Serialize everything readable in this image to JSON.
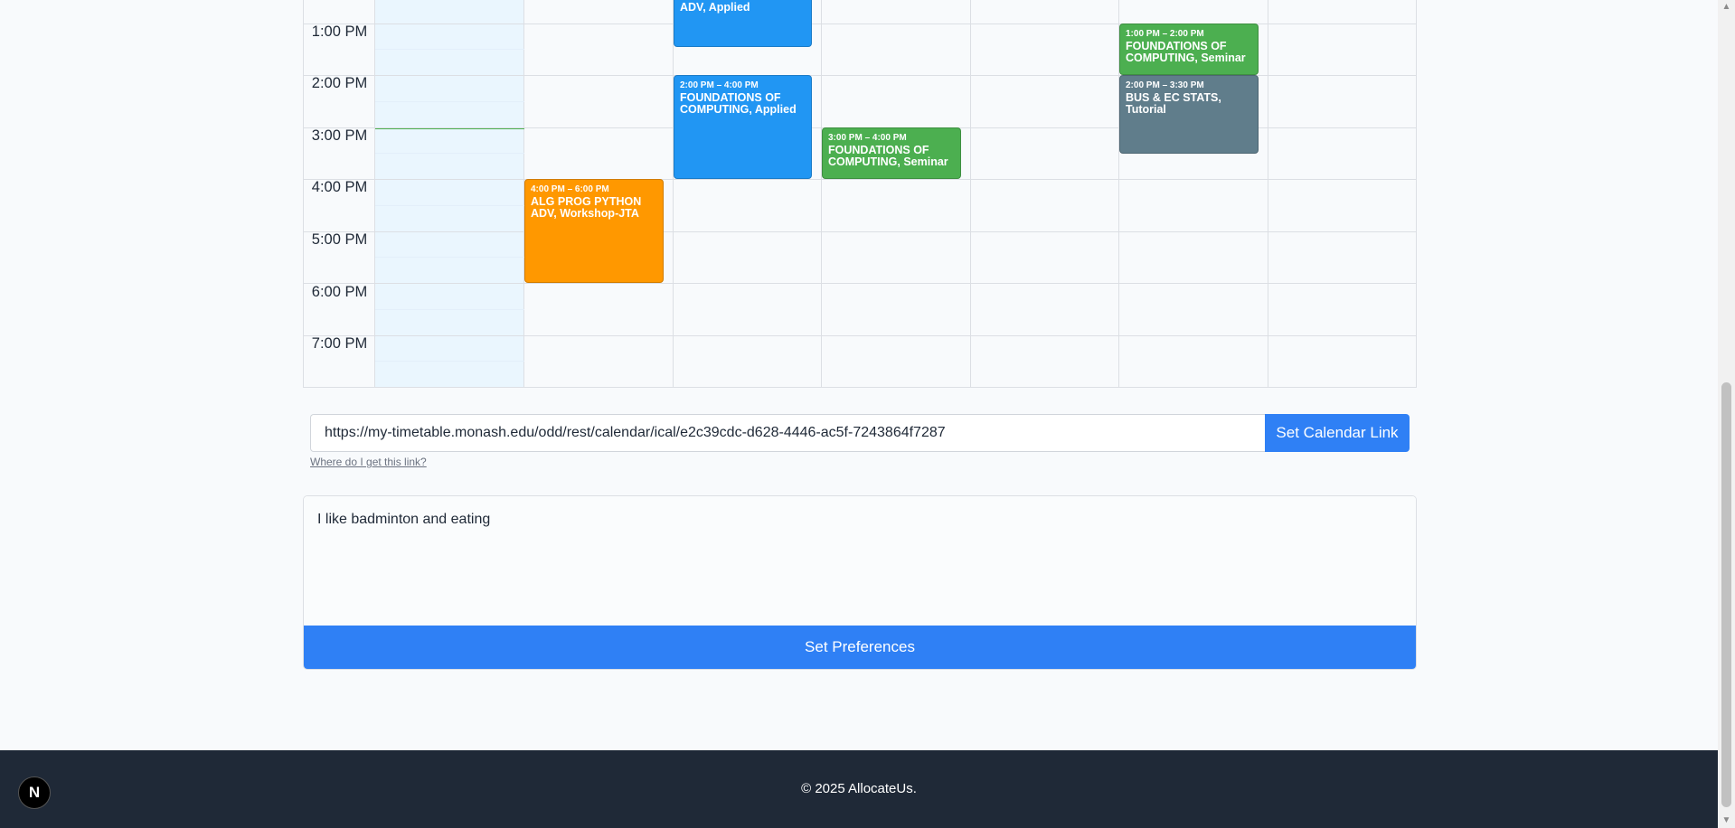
{
  "calendar": {
    "time_labels": [
      "1:00 PM",
      "2:00 PM",
      "3:00 PM",
      "4:00 PM",
      "5:00 PM",
      "6:00 PM",
      "7:00 PM"
    ],
    "events": [
      {
        "time": "",
        "title": "ADV, Applied",
        "color": "#2196f3"
      },
      {
        "time": "2:00 PM – 4:00 PM",
        "title": "FOUNDATIONS OF COMPUTING, Applied",
        "color": "#2196f3"
      },
      {
        "time": "4:00 PM – 6:00 PM",
        "title": "ALG PROG PYTHON ADV, Workshop-JTA",
        "color": "#ff9800"
      },
      {
        "time": "3:00 PM – 4:00 PM",
        "title": "FOUNDATIONS OF COMPUTING, Seminar",
        "color": "#4caf50"
      },
      {
        "time": "1:00 PM – 2:00 PM",
        "title": "FOUNDATIONS OF COMPUTING, Seminar",
        "color": "#4caf50"
      },
      {
        "time": "2:00 PM – 3:30 PM",
        "title": "BUS & EC STATS, Tutorial",
        "color": "#607d8b"
      }
    ]
  },
  "link": {
    "value": "https://my-timetable.monash.edu/odd/rest/calendar/ical/e2c39cdc-d628-4446-ac5f-7243864f7287",
    "button_label": "Set Calendar Link",
    "help_text": "Where do I get this link?"
  },
  "preferences": {
    "value": "I like badminton and eating",
    "button_label": "Set Preferences"
  },
  "footer": {
    "text": "© 2025 AllocateUs.",
    "badge_letter": "N"
  },
  "scrollbar": {
    "up_arrow": "▲",
    "down_arrow": "▼"
  }
}
